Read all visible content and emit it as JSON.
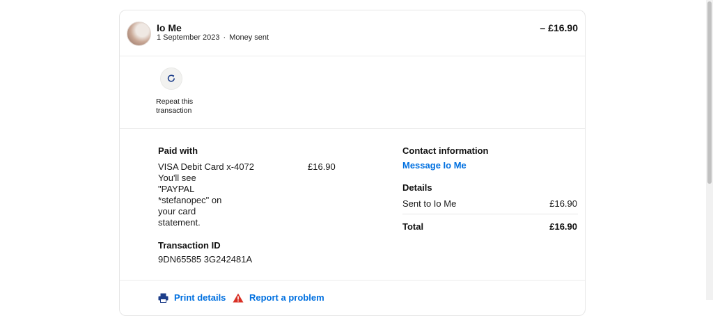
{
  "transaction": {
    "name": "Io Me",
    "date": "1 September 2023",
    "separator": "·",
    "type": "Money sent",
    "amount": "– £16.90"
  },
  "repeat": {
    "label": "Repeat this transaction"
  },
  "paid_with": {
    "heading": "Paid with",
    "card": "VISA Debit Card x-4072",
    "note": "You'll see \"PAYPAL *stefanopec\" on your card statement.",
    "amount": "£16.90"
  },
  "transaction_id": {
    "heading": "Transaction ID",
    "value": "9DN65585 3G242481A"
  },
  "contact": {
    "heading": "Contact information",
    "message_link": "Message Io Me"
  },
  "details": {
    "heading": "Details",
    "sent_label": "Sent to Io Me",
    "sent_amount": "£16.90",
    "total_label": "Total",
    "total_amount": "£16.90"
  },
  "footer": {
    "print_label": "Print details",
    "report_label": "Report a problem"
  },
  "colors": {
    "link": "#0070e0",
    "border": "#e6e6e6",
    "warning": "#d93025"
  },
  "icons": [
    "repeat-icon",
    "printer-icon",
    "warning-icon"
  ]
}
